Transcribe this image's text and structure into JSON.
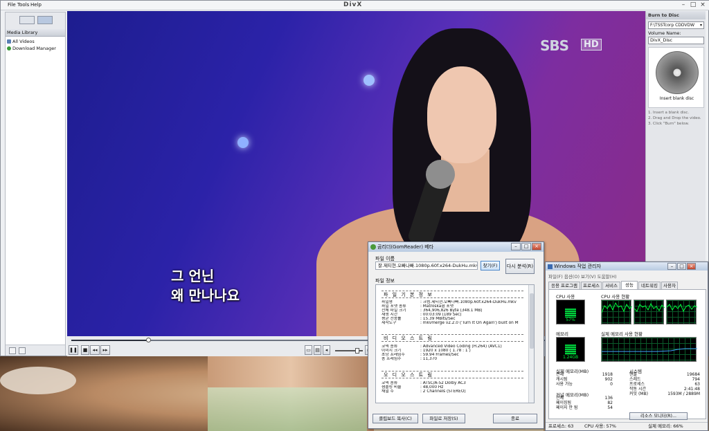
{
  "divx": {
    "menu": [
      "File",
      "Tools",
      "Help"
    ],
    "logo": "DivX"
  },
  "media_library": {
    "header": "Media Library",
    "items": [
      {
        "label": "All Videos",
        "icon": "film-icon"
      },
      {
        "label": "Download Manager",
        "icon": "download-icon"
      }
    ]
  },
  "video": {
    "channel": "SBS",
    "channel_badge": "HD",
    "subtitle_line1": "그 언닌",
    "subtitle_line2": "왜 만나나요"
  },
  "playback": {
    "progress": 0.135,
    "volume": 0.8
  },
  "burn": {
    "header": "Burn to Disc",
    "drive": "F:\\TSSTcorp CDDVDW",
    "volume_label": "Volume Name:",
    "volume_name": "DivX_Disc",
    "disc_label": "Insert blank disc",
    "steps": [
      "1. Insert a blank disc.",
      "2. Drag and Drop the video.",
      "3. Click \"Burn\" below."
    ]
  },
  "gom": {
    "title": "곰리더(GomReader) 베타",
    "file_name_label": "파일 이름",
    "file_name": "잘.제티현.오빠나빠.1080p.60f.x264-DukHu.mkv",
    "find_button": "찾기(F)",
    "reanalyze_button": "다시 분석(R)",
    "file_info_label": "파일 정보",
    "basic_header": "파 일 기 본 정 보",
    "basic_rows": [
      {
        "k": "파일명",
        "v": ": 크럼.제티현.오빠나빠.1080p.60f.x264-DukHu.mkv"
      },
      {
        "k": "파일 포맷 종류",
        "v": ": Matroska형 포맷"
      },
      {
        "k": "전체 파일 크기",
        "v": ": 364,906,826 Byte (348.1 MB)"
      },
      {
        "k": "재생 시간",
        "v": ": 00:03:09  (189 Sec)"
      },
      {
        "k": "평균 전송률",
        "v": ": 15.39 MBits/Sec"
      },
      {
        "k": "제작도구",
        "v": ": mkvmerge v2.2.0 ('Turn It On Again') built on M"
      }
    ],
    "video_header": "비 디 오 스 트 림",
    "video_rows": [
      {
        "k": "코덱 종류",
        "v": ": Advanced Video Coding (H.264) (AVC1)"
      },
      {
        "k": "이미지 크기",
        "v": ": 1920 x 1080  ( 1.78 : 1 )"
      },
      {
        "k": "초당 프레임수",
        "v": ": 59.94 Frames/Sec"
      },
      {
        "k": "총 프레임수",
        "v": ": 11,370"
      }
    ],
    "audio_header": "오 디 오 스 트 림",
    "audio_rows": [
      {
        "k": "코덱 종류",
        "v": ": ATSC/A-52 Dolby AC3"
      },
      {
        "k": "샘플링 비율",
        "v": ": 48,000 Hz"
      },
      {
        "k": "채널 수",
        "v": ": 2 Channels (STEREO)"
      }
    ],
    "copy_button": "클립보드 복사(C)",
    "save_button": "파일로 저장(S)",
    "close_button": "종료"
  },
  "taskmgr": {
    "title": "Windows 작업 관리자",
    "menu": "파일(F)  옵션(O)  보기(V)  도움말(H)",
    "tabs": [
      "응용 프로그램",
      "프로세스",
      "서비스",
      "성능",
      "네트워킹",
      "사용자"
    ],
    "active_tab": 3,
    "cpu_usage_label": "CPU 사용",
    "cpu_history_label": "CPU 사용 현황",
    "cpu_percent_text": "57%",
    "cpu_level": 0.57,
    "memory_label": "메모리",
    "memory_history_label": "실제 메모리 사용 현황",
    "memory_text": "1.24GB",
    "memory_level": 0.66,
    "phys_header": "실제 메모리(MB)",
    "phys_rows": [
      {
        "k": "전체",
        "v": "1918"
      },
      {
        "k": "캐시됨",
        "v": "902"
      },
      {
        "k": "사용 가능",
        "v": "0"
      }
    ],
    "kernel_header": "커널 메모리(MB)",
    "kernel_rows": [
      {
        "k": "전체",
        "v": "136"
      },
      {
        "k": "페이징됨",
        "v": "82"
      },
      {
        "k": "페이지 안 됨",
        "v": "54"
      }
    ],
    "system_header": "시스템",
    "system_rows": [
      {
        "k": "핸들",
        "v": "19684"
      },
      {
        "k": "스레드",
        "v": "794"
      },
      {
        "k": "프로세스",
        "v": "63"
      },
      {
        "k": "작동 시간",
        "v": "2:41:48"
      },
      {
        "k": "커밋 (MB)",
        "v": "1593M / 2889M"
      }
    ],
    "resmon_button": "리소스 모니터(R)...",
    "status_processes": "프로세스: 63",
    "status_cpu": "CPU 사용: 57%",
    "status_memory": "실제 메모리: 66%"
  }
}
